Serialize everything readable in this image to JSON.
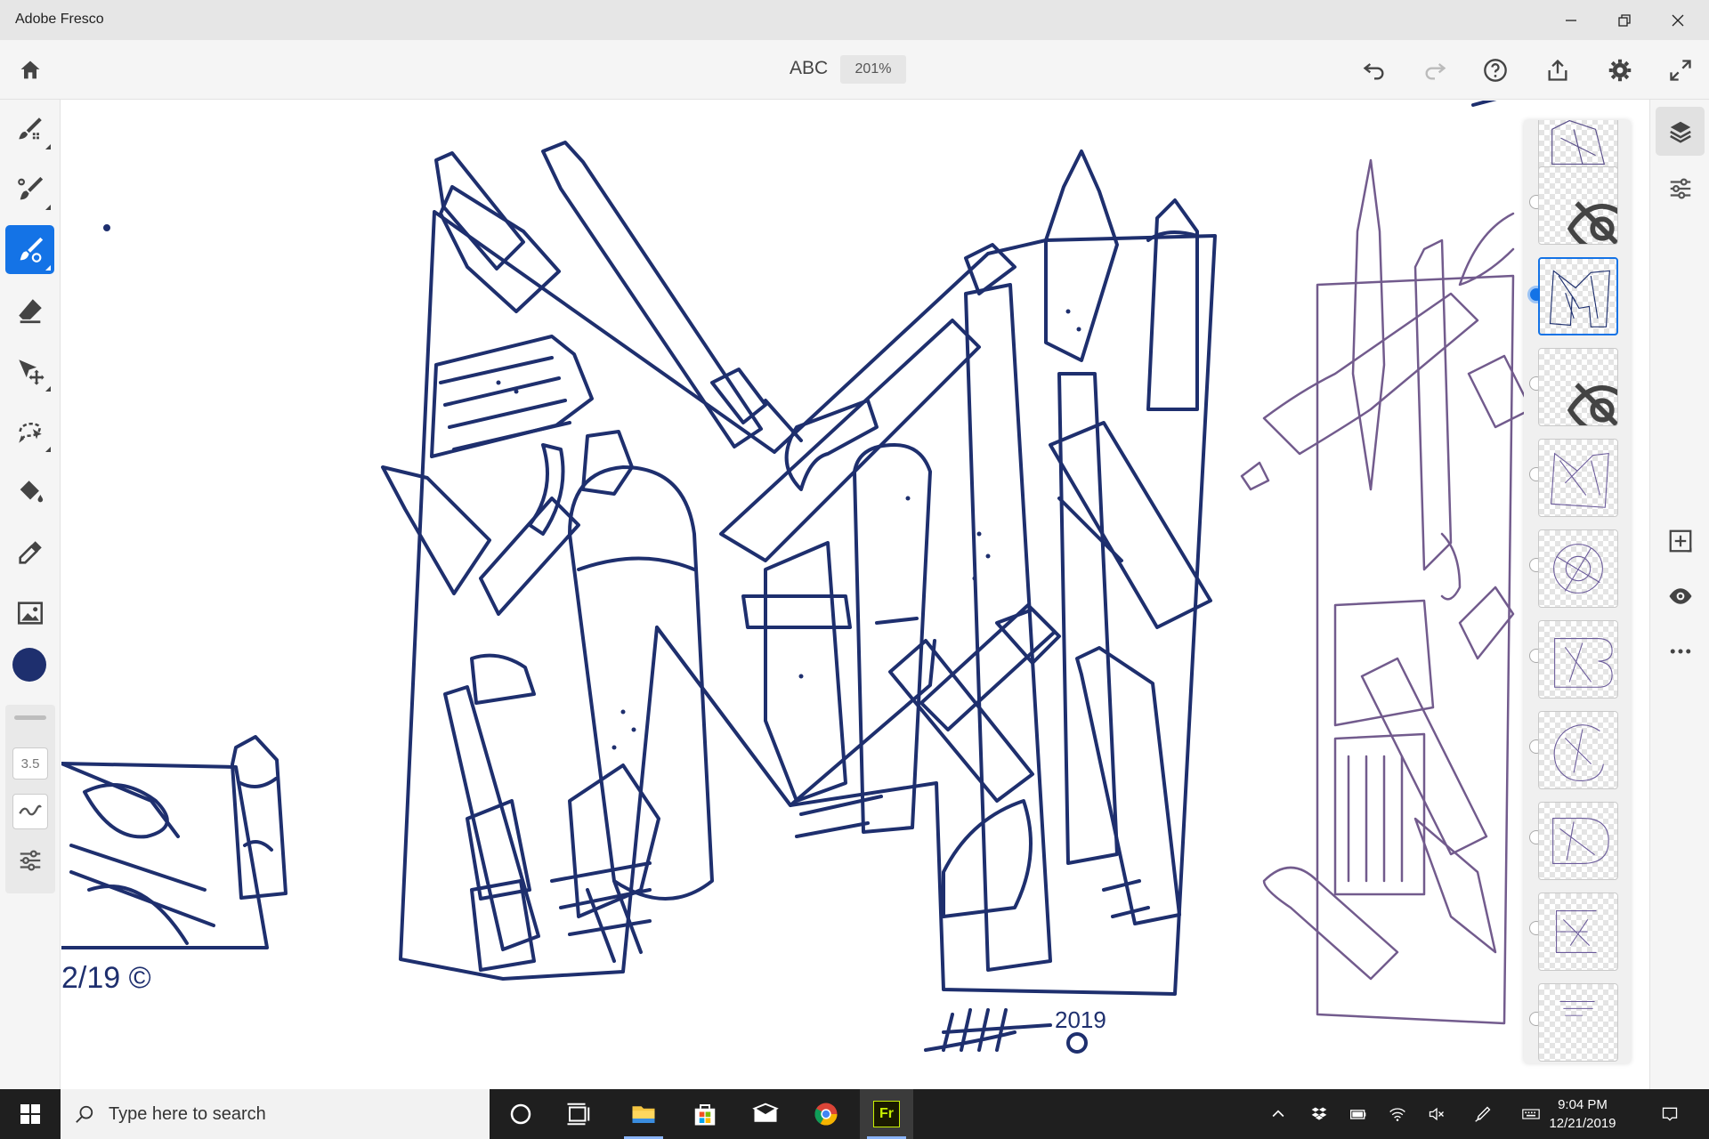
{
  "window": {
    "title": "Adobe Fresco",
    "controls": [
      "minimize",
      "restore",
      "close"
    ]
  },
  "toolbar": {
    "document_name": "ABC",
    "zoom": "201%",
    "icons": [
      "home-icon",
      "undo-icon",
      "redo-icon",
      "help-icon",
      "share-icon",
      "settings-icon",
      "fullscreen-icon"
    ]
  },
  "tools": {
    "items": [
      "pixel-brush",
      "live-brush",
      "vector-brush",
      "eraser",
      "transform",
      "selection",
      "fill",
      "eyedropper",
      "place-image"
    ],
    "active": "vector-brush",
    "color": "#1e2f6e",
    "brush_size": "3.5"
  },
  "right_rail": {
    "icons": [
      "layers-icon",
      "layer-properties-icon",
      "add-layer-icon",
      "visibility-icon",
      "more-icon"
    ]
  },
  "layers": {
    "count": 11,
    "selected_index": 2,
    "hidden_indices": [
      1,
      3
    ]
  },
  "colors": {
    "accent": "#1473e6",
    "ink": "#1e2f6e",
    "sketch": "#5a3f7a"
  },
  "taskbar": {
    "search_placeholder": "Type here to search",
    "apps": [
      "cortana",
      "task-view",
      "file-explorer",
      "store",
      "mail",
      "chrome",
      "fresco"
    ],
    "active_app_label": "Fr",
    "time": "9:04 PM",
    "date": "12/21/2019"
  },
  "artwork": {
    "signature_year": "2019"
  }
}
